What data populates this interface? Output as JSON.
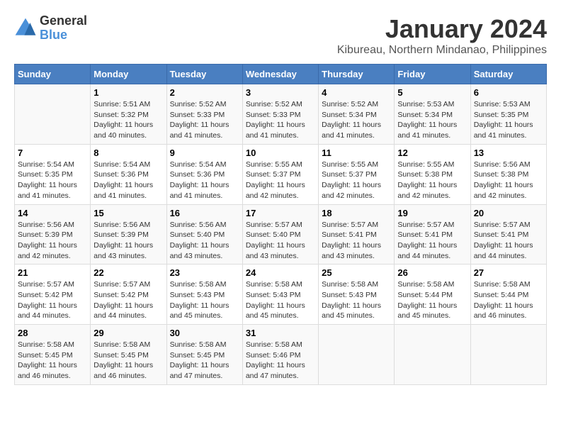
{
  "header": {
    "logo_general": "General",
    "logo_blue": "Blue",
    "main_title": "January 2024",
    "subtitle": "Kibureau, Northern Mindanao, Philippines"
  },
  "days_of_week": [
    "Sunday",
    "Monday",
    "Tuesday",
    "Wednesday",
    "Thursday",
    "Friday",
    "Saturday"
  ],
  "weeks": [
    [
      {
        "day": "",
        "info": ""
      },
      {
        "day": "1",
        "info": "Sunrise: 5:51 AM\nSunset: 5:32 PM\nDaylight: 11 hours\nand 40 minutes."
      },
      {
        "day": "2",
        "info": "Sunrise: 5:52 AM\nSunset: 5:33 PM\nDaylight: 11 hours\nand 41 minutes."
      },
      {
        "day": "3",
        "info": "Sunrise: 5:52 AM\nSunset: 5:33 PM\nDaylight: 11 hours\nand 41 minutes."
      },
      {
        "day": "4",
        "info": "Sunrise: 5:52 AM\nSunset: 5:34 PM\nDaylight: 11 hours\nand 41 minutes."
      },
      {
        "day": "5",
        "info": "Sunrise: 5:53 AM\nSunset: 5:34 PM\nDaylight: 11 hours\nand 41 minutes."
      },
      {
        "day": "6",
        "info": "Sunrise: 5:53 AM\nSunset: 5:35 PM\nDaylight: 11 hours\nand 41 minutes."
      }
    ],
    [
      {
        "day": "7",
        "info": "Sunrise: 5:54 AM\nSunset: 5:35 PM\nDaylight: 11 hours\nand 41 minutes."
      },
      {
        "day": "8",
        "info": "Sunrise: 5:54 AM\nSunset: 5:36 PM\nDaylight: 11 hours\nand 41 minutes."
      },
      {
        "day": "9",
        "info": "Sunrise: 5:54 AM\nSunset: 5:36 PM\nDaylight: 11 hours\nand 41 minutes."
      },
      {
        "day": "10",
        "info": "Sunrise: 5:55 AM\nSunset: 5:37 PM\nDaylight: 11 hours\nand 42 minutes."
      },
      {
        "day": "11",
        "info": "Sunrise: 5:55 AM\nSunset: 5:37 PM\nDaylight: 11 hours\nand 42 minutes."
      },
      {
        "day": "12",
        "info": "Sunrise: 5:55 AM\nSunset: 5:38 PM\nDaylight: 11 hours\nand 42 minutes."
      },
      {
        "day": "13",
        "info": "Sunrise: 5:56 AM\nSunset: 5:38 PM\nDaylight: 11 hours\nand 42 minutes."
      }
    ],
    [
      {
        "day": "14",
        "info": "Sunrise: 5:56 AM\nSunset: 5:39 PM\nDaylight: 11 hours\nand 42 minutes."
      },
      {
        "day": "15",
        "info": "Sunrise: 5:56 AM\nSunset: 5:39 PM\nDaylight: 11 hours\nand 43 minutes."
      },
      {
        "day": "16",
        "info": "Sunrise: 5:56 AM\nSunset: 5:40 PM\nDaylight: 11 hours\nand 43 minutes."
      },
      {
        "day": "17",
        "info": "Sunrise: 5:57 AM\nSunset: 5:40 PM\nDaylight: 11 hours\nand 43 minutes."
      },
      {
        "day": "18",
        "info": "Sunrise: 5:57 AM\nSunset: 5:41 PM\nDaylight: 11 hours\nand 43 minutes."
      },
      {
        "day": "19",
        "info": "Sunrise: 5:57 AM\nSunset: 5:41 PM\nDaylight: 11 hours\nand 44 minutes."
      },
      {
        "day": "20",
        "info": "Sunrise: 5:57 AM\nSunset: 5:41 PM\nDaylight: 11 hours\nand 44 minutes."
      }
    ],
    [
      {
        "day": "21",
        "info": "Sunrise: 5:57 AM\nSunset: 5:42 PM\nDaylight: 11 hours\nand 44 minutes."
      },
      {
        "day": "22",
        "info": "Sunrise: 5:57 AM\nSunset: 5:42 PM\nDaylight: 11 hours\nand 44 minutes."
      },
      {
        "day": "23",
        "info": "Sunrise: 5:58 AM\nSunset: 5:43 PM\nDaylight: 11 hours\nand 45 minutes."
      },
      {
        "day": "24",
        "info": "Sunrise: 5:58 AM\nSunset: 5:43 PM\nDaylight: 11 hours\nand 45 minutes."
      },
      {
        "day": "25",
        "info": "Sunrise: 5:58 AM\nSunset: 5:43 PM\nDaylight: 11 hours\nand 45 minutes."
      },
      {
        "day": "26",
        "info": "Sunrise: 5:58 AM\nSunset: 5:44 PM\nDaylight: 11 hours\nand 45 minutes."
      },
      {
        "day": "27",
        "info": "Sunrise: 5:58 AM\nSunset: 5:44 PM\nDaylight: 11 hours\nand 46 minutes."
      }
    ],
    [
      {
        "day": "28",
        "info": "Sunrise: 5:58 AM\nSunset: 5:45 PM\nDaylight: 11 hours\nand 46 minutes."
      },
      {
        "day": "29",
        "info": "Sunrise: 5:58 AM\nSunset: 5:45 PM\nDaylight: 11 hours\nand 46 minutes."
      },
      {
        "day": "30",
        "info": "Sunrise: 5:58 AM\nSunset: 5:45 PM\nDaylight: 11 hours\nand 47 minutes."
      },
      {
        "day": "31",
        "info": "Sunrise: 5:58 AM\nSunset: 5:46 PM\nDaylight: 11 hours\nand 47 minutes."
      },
      {
        "day": "",
        "info": ""
      },
      {
        "day": "",
        "info": ""
      },
      {
        "day": "",
        "info": ""
      }
    ]
  ]
}
